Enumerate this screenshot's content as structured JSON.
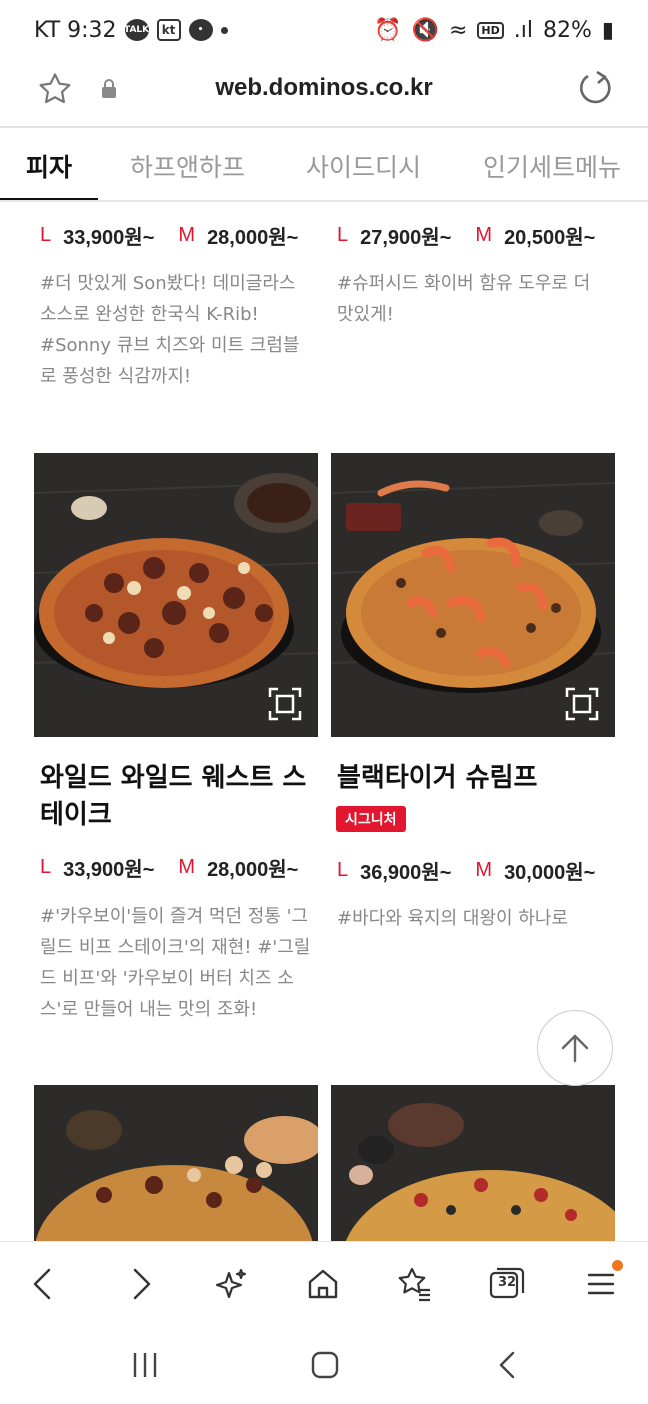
{
  "status": {
    "carrier_time": "KT 9:32",
    "icons": [
      "talk-icon",
      "kt-icon",
      "chat-icon"
    ],
    "hd": "HD",
    "battery": "82%"
  },
  "browser": {
    "url": "web.dominos.co.kr",
    "tab_count": "32"
  },
  "tabs": [
    "피자",
    "하프앤하프",
    "사이드디시",
    "인기세트메뉴"
  ],
  "top_cards": [
    {
      "price_l_label": "L",
      "price_l": "33,900원~",
      "price_m_label": "M",
      "price_m": "28,000원~",
      "desc": "#더 맛있게 Son봤다! 데미글라스 소스로 완성한 한국식 K-Rib! #Sonny 큐브 치즈와 미트 크럼블로 풍성한 식감까지!"
    },
    {
      "price_l_label": "L",
      "price_l": "27,900원~",
      "price_m_label": "M",
      "price_m": "20,500원~",
      "desc": "#슈퍼시드 화이버 함유 도우로 더 맛있게!"
    }
  ],
  "cards": [
    {
      "name": "와일드 와일드 웨스트 스테이크",
      "badge": "",
      "price_l_label": "L",
      "price_l": "33,900원~",
      "price_m_label": "M",
      "price_m": "28,000원~",
      "desc": "#'카우보이'들이 즐겨 먹던 정통 '그릴드 비프 스테이크'의 재현! #'그릴드 비프'와 '카우보이 버터 치즈 소스'로 만들어 내는 맛의 조화!"
    },
    {
      "name": "블랙타이거 슈림프",
      "badge": "시그니처",
      "price_l_label": "L",
      "price_l": "36,900원~",
      "price_m_label": "M",
      "price_m": "30,000원~",
      "desc": "#바다와 육지의 대왕이 하나로"
    }
  ],
  "colors": {
    "accent": "#e2162e",
    "notif_dot": "#f5761a"
  }
}
